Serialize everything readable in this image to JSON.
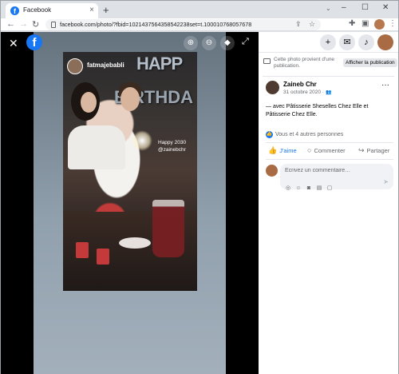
{
  "browser": {
    "tab_title": "Facebook",
    "tab_close": "×",
    "new_tab": "+",
    "url": "facebook.com/photo/?fbid=1021437564358542238set=t.100010768057678",
    "window_controls": {
      "minimize": "–",
      "maximize": "☐",
      "close": "✕"
    }
  },
  "viewer": {
    "close_glyph": "✕",
    "fb_logo": "f",
    "photo_overlay": {
      "username": "fatmajebabli",
      "balloon_letters_top": "HAPP",
      "balloon_letters_bottom": "BIRTHDA",
      "caption_line1": "Happy 2030",
      "caption_line2": "@zainebchr"
    }
  },
  "panel": {
    "notice_text": "Cette photo provient d'une publication.",
    "notice_button": "Afficher la publication",
    "author_name": "Zaineb Chr",
    "post_date": "31 octobre 2020 ·",
    "post_text": "— avec Pâtisserie Sheselles Chez Elle et Pâtisserie Chez Elle.",
    "reactions_text": "Vous et 4 autres personnes",
    "actions": {
      "like": "J'aime",
      "comment": "Commenter",
      "share": "Partager"
    },
    "comment_placeholder": "Écrivez un commentaire…"
  },
  "colors": {
    "facebook_blue": "#1877f2",
    "viewer_bg": "#000000"
  },
  "icons": [
    "facebook-favicon",
    "lock-icon",
    "zoom-in-icon",
    "zoom-out-icon",
    "tag-icon",
    "fullscreen-icon",
    "plus-icon",
    "messenger-icon",
    "bell-icon",
    "like-icon",
    "comment-icon",
    "share-icon"
  ]
}
